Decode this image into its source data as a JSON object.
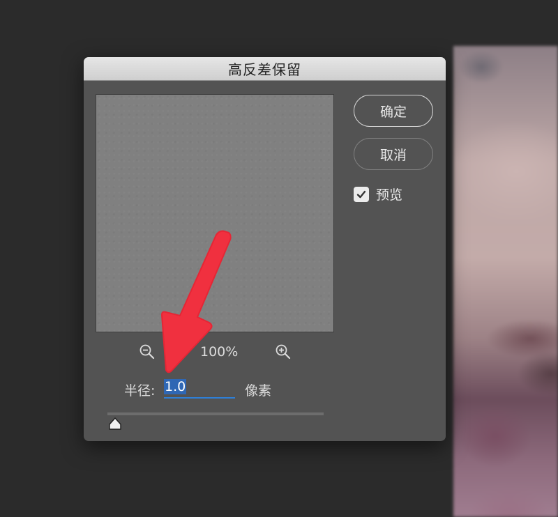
{
  "dialog": {
    "title": "高反差保留",
    "zoom": {
      "level": "100%",
      "zoom_out_icon": "zoom-out-magnifier-icon",
      "zoom_in_icon": "zoom-in-magnifier-icon"
    },
    "radius": {
      "label": "半径:",
      "value": "1.0",
      "unit": "像素",
      "slider_value_fraction": 0.0
    },
    "buttons": {
      "ok_label": "确定",
      "cancel_label": "取消"
    },
    "preview_toggle": {
      "label": "预览",
      "checked": true
    }
  },
  "colors": {
    "dialog_bg": "#535353",
    "input_underline": "#2f7fd7",
    "annotation_arrow": "#f0303f"
  }
}
